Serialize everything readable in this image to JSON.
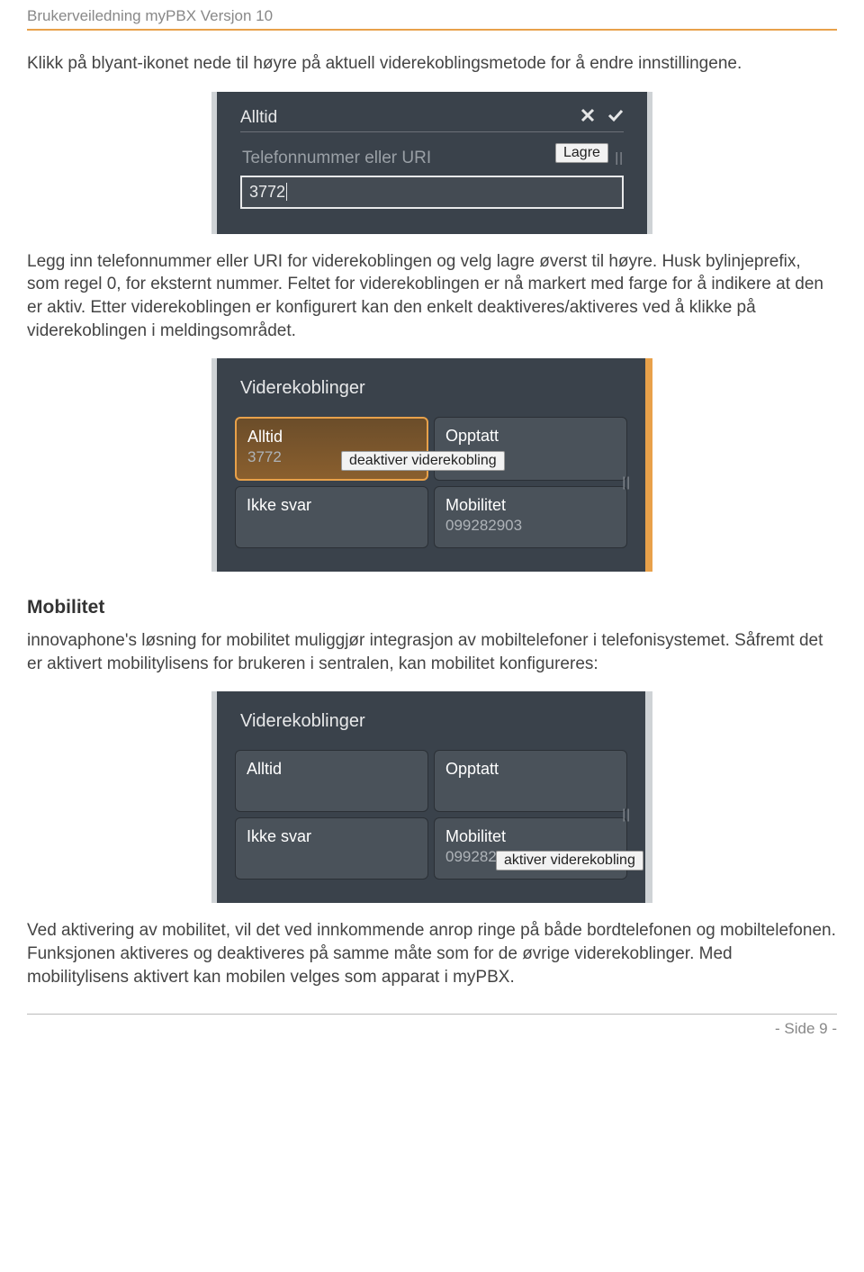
{
  "doc": {
    "header": "Brukerveiledning myPBX Versjon 10",
    "footer": "- Side 9 -"
  },
  "p1": "Klikk på blyant-ikonet nede til høyre på aktuell viderekoblingsmetode for å endre innstillingene.",
  "shot1": {
    "title": "Alltid",
    "placeholder": "Telefonnummer eller URI",
    "value": "3772",
    "save_tooltip": "Lagre"
  },
  "p2": "Legg inn telefonnummer eller URI for viderekoblingen og velg lagre øverst til høyre. Husk bylinjeprefix, som regel 0, for eksternt nummer. Feltet for viderekoblingen er nå markert med farge for å indikere at den er aktiv. Etter viderekoblingen er konfigurert kan den enkelt deaktiveres/aktiveres ved å klikke på viderekoblingen i meldingsområdet.",
  "shot2": {
    "title": "Viderekoblinger",
    "tooltip": "deaktiver viderekobling",
    "tiles": {
      "alltid": {
        "label": "Alltid",
        "value": "3772"
      },
      "opptatt": {
        "label": "Opptatt"
      },
      "ikkesvar": {
        "label": "Ikke svar"
      },
      "mobilitet": {
        "label": "Mobilitet",
        "value": "099282903"
      }
    }
  },
  "h_mobilitet": "Mobilitet",
  "p3": "innovaphone's løsning for mobilitet muliggjør integrasjon av mobiltelefoner i telefonisystemet. Såfremt det er aktivert mobilitylisens for brukeren i sentralen, kan mobilitet konfigureres:",
  "shot3": {
    "title": "Viderekoblinger",
    "tooltip": "aktiver viderekobling",
    "tiles": {
      "alltid": {
        "label": "Alltid"
      },
      "opptatt": {
        "label": "Opptatt"
      },
      "ikkesvar": {
        "label": "Ikke svar"
      },
      "mobilitet": {
        "label": "Mobilitet",
        "value": "099282903"
      }
    }
  },
  "p4": "Ved aktivering av mobilitet, vil det ved innkommende anrop ringe på både bordtelefonen og mobiltelefonen. Funksjonen aktiveres og deaktiveres på samme måte som for de øvrige viderekoblinger. Med mobilitylisens aktivert kan mobilen velges som apparat i myPBX."
}
